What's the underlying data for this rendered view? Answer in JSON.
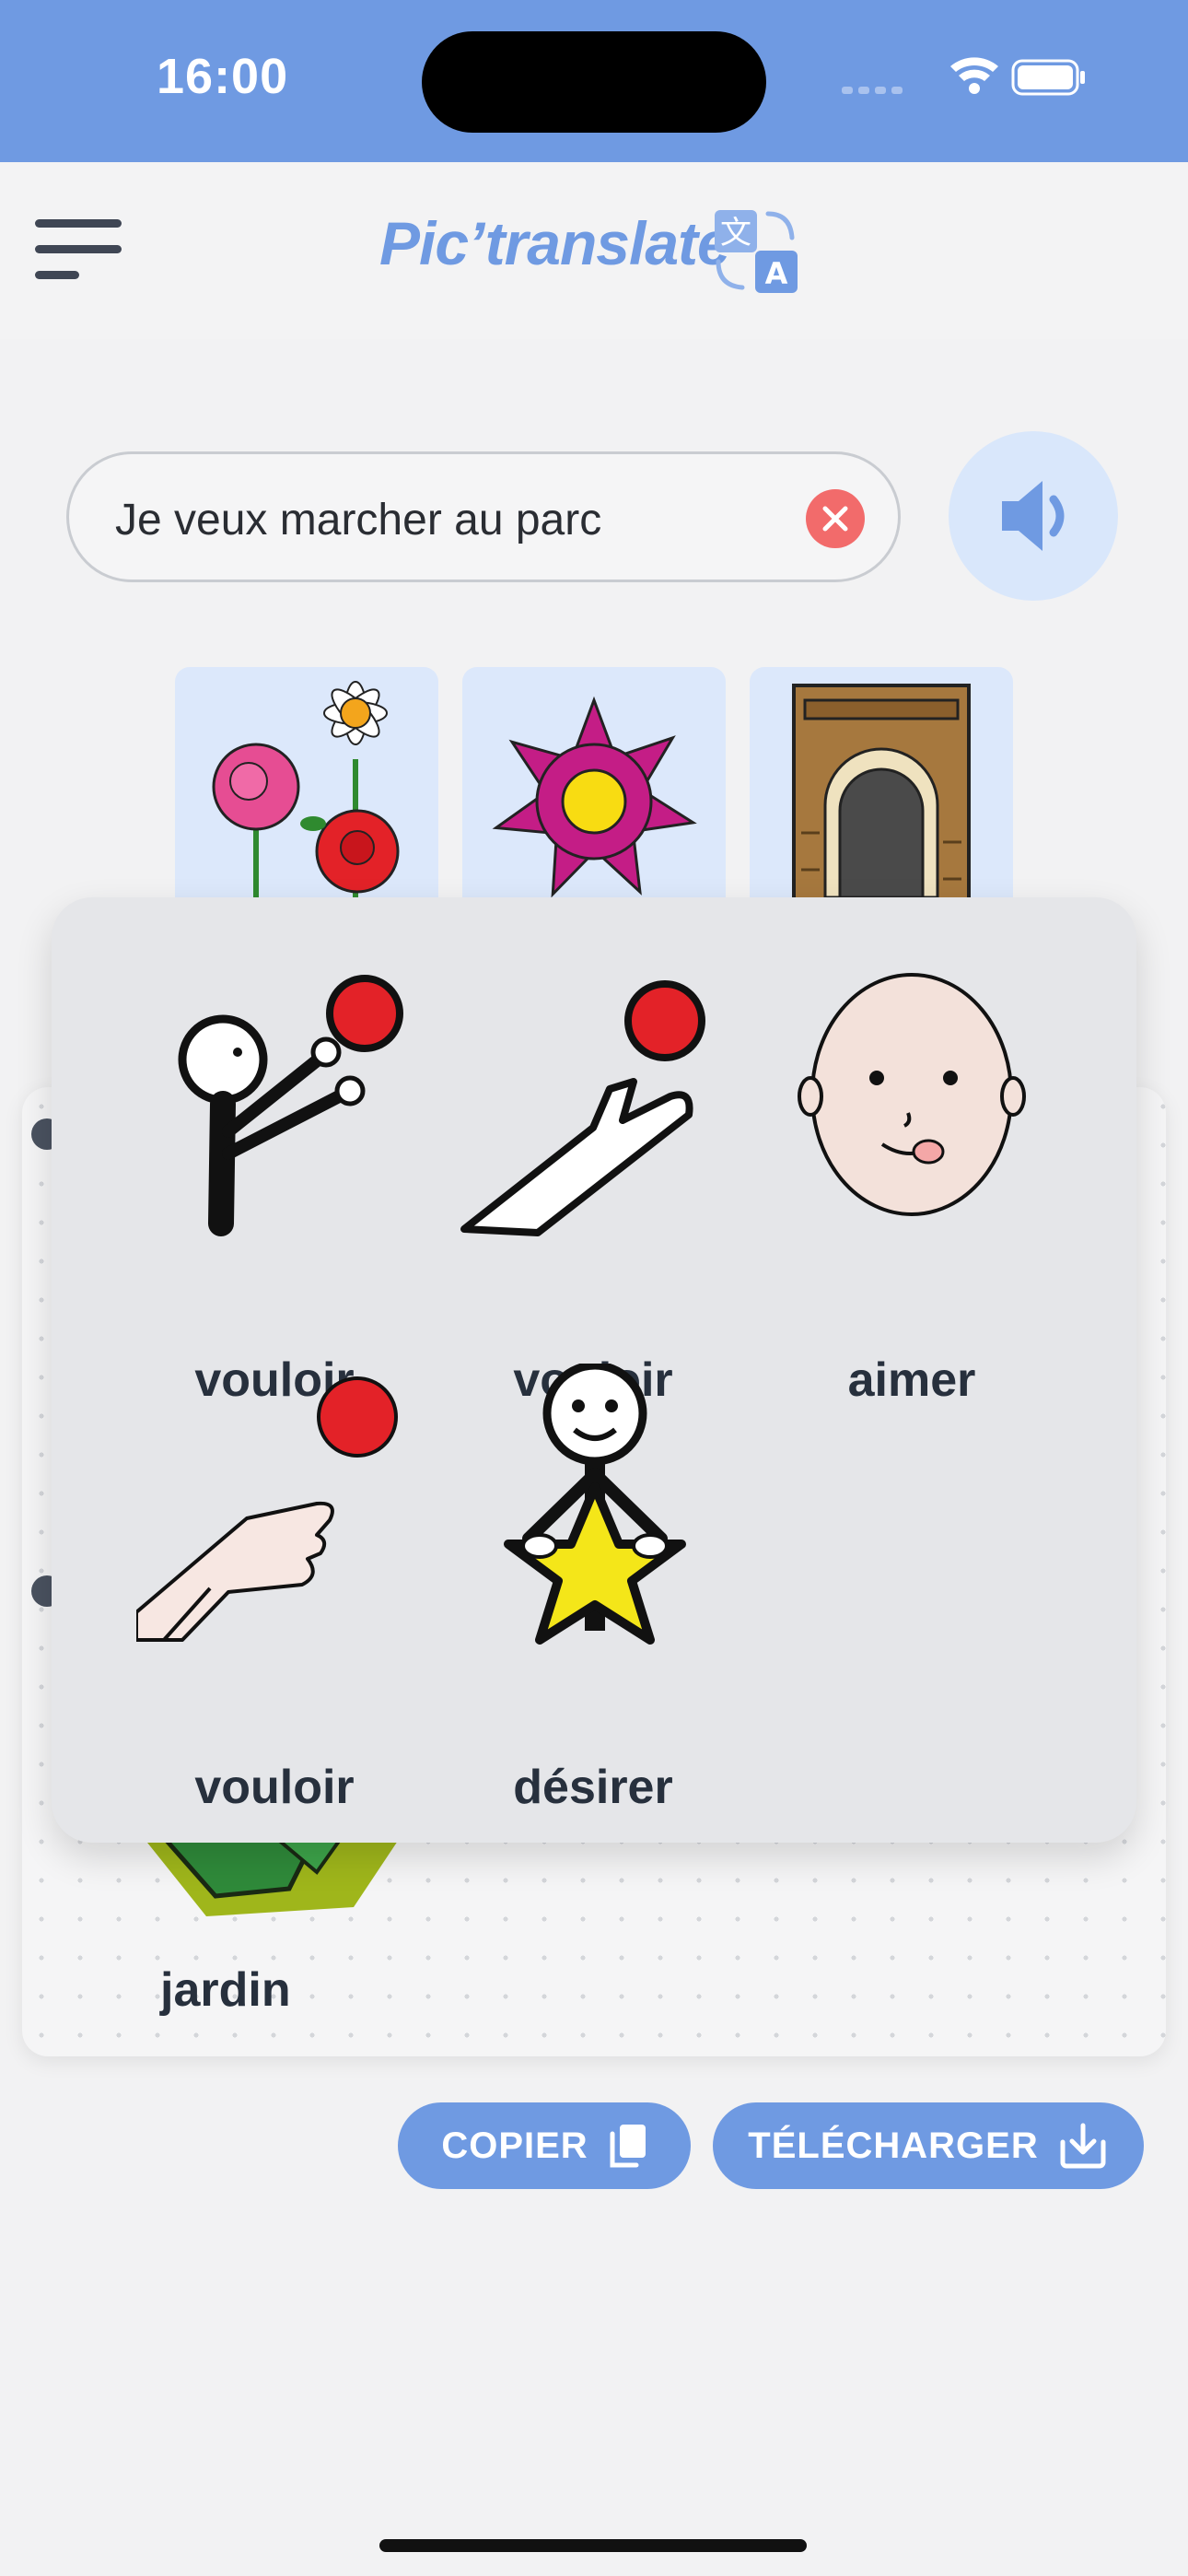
{
  "status_bar": {
    "time": "16:00"
  },
  "header": {
    "title": "Pic’translate"
  },
  "search": {
    "value": "Je veux marcher au parc"
  },
  "result_card": {
    "word": "jardin"
  },
  "popup": {
    "items": [
      {
        "label": "vouloir",
        "icon": "child-reaching-ball-icon"
      },
      {
        "label": "vouloir",
        "icon": "arm-reaching-ball-icon"
      },
      {
        "label": "aimer",
        "icon": "face-licking-lips-icon"
      },
      {
        "label": "vouloir",
        "icon": "hand-reaching-ball-icon"
      },
      {
        "label": "désirer",
        "icon": "person-holding-star-icon"
      }
    ]
  },
  "actions": {
    "copy_label": "COPIER",
    "download_label": "TÉLÉCHARGER"
  },
  "colors": {
    "accent": "#6f9ae2",
    "clear": "#f26b6b",
    "speaker_bg": "#d9e7fb"
  }
}
